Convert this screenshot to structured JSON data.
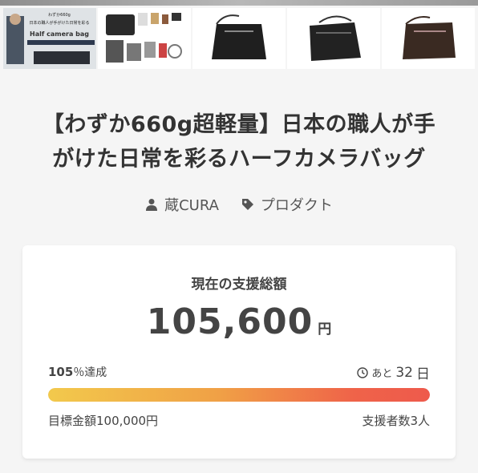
{
  "thumbnails": [
    {
      "name": "thumb-model-with-bag",
      "text_lines": [
        "わずか660g",
        "日本の職人が手がけた日常を彩る",
        "Half camera bag"
      ],
      "selected": true
    },
    {
      "name": "thumb-bag-contents"
    },
    {
      "name": "thumb-bag-front"
    },
    {
      "name": "thumb-bag-angle"
    },
    {
      "name": "thumb-bag-brown"
    }
  ],
  "project": {
    "title_line1": "【わずか660g超軽量】日本の職人が手",
    "title_line2": "がけた日常を彩るハーフカメラバッグ",
    "owner": "蔵CURA",
    "category": "プロダクト"
  },
  "funding": {
    "label": "現在の支援総額",
    "amount": "105,600",
    "currency": "円",
    "percent": "105",
    "percent_suffix": "％達成",
    "remaining_prefix": "あと",
    "remaining_days": "32",
    "remaining_unit": "日",
    "progress_fraction": 1.0,
    "goal": "目標金額100,000円",
    "backers": "支援者数3人"
  },
  "colors": {
    "progress_start": "#f2c94c",
    "progress_end": "#ee5a4c"
  },
  "icons": {
    "owner": "person-icon",
    "category": "tag-icon",
    "remaining": "clock-icon"
  }
}
